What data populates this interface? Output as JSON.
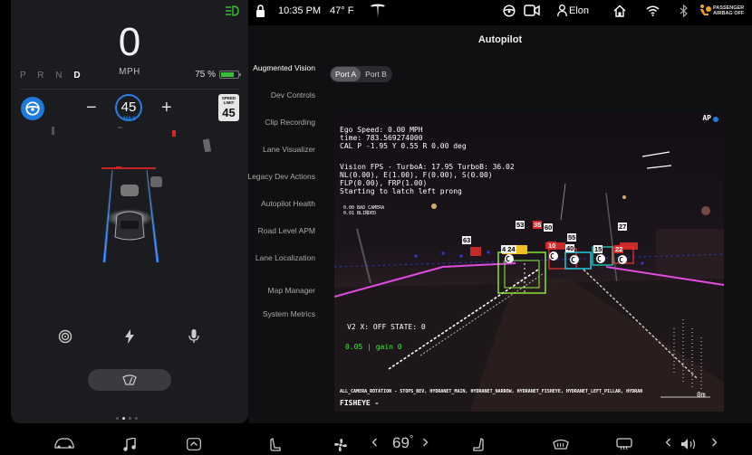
{
  "status_bar": {
    "time": "10:35 PM",
    "temperature": "47° F",
    "user": "Elon",
    "airbag_line1": "PASSENGER",
    "airbag_line2": "AIRBAG OFF"
  },
  "drive": {
    "speed": "0",
    "unit": "MPH",
    "gears": [
      "P",
      "R",
      "N",
      "D"
    ],
    "active_gear": "D",
    "battery_percent": "75 %",
    "battery_level": 0.75,
    "set_speed": "45",
    "set_speed_label": "MAX",
    "minus_label": "−",
    "plus_label": "+",
    "speed_limit_title": "SPEED LIMIT",
    "speed_limit_value": "45"
  },
  "autopilot": {
    "title": "Autopilot",
    "menu": [
      "Augmented Vision",
      "Dev Controls",
      "Clip Recording",
      "Lane Visualizer",
      "Legacy Dev Actions",
      "Autopilot Health",
      "Road Level APM",
      "Lane Localization",
      "Map Manager",
      "System Metrics"
    ],
    "ports": [
      "Port A",
      "Port B"
    ],
    "active_port": "Port A",
    "camera": {
      "badge": "AP",
      "telemetry": "Ego Speed: 0.00 MPH\ntime: 783.569274000\nCAL P -1.95 Y 0.55 R 0.00 deg",
      "vision": "Vision FPS - TurboA: 17.95 TurboB: 36.02\nNL(0.00), E(1.00), F(0.00), S(0.00)\nFLP(0.00), FRP(1.00)\nStarting to latch left prong",
      "camera_flags": "0.00 BAD_CAMERA\n0.01 BLINDED",
      "v2": "V2 X: OFF STATE: 0",
      "gain": "0.05 | gain 0",
      "rotation": "ALL_CAMERA_ROTATION - STOPS_BEV, HYDRANET_MAIN, HYDRANET_NARROW, HYDRANET_FISHEYE, HYDRANET_LEFT_PILLAR, HYDRAN",
      "fisheye": "FISHEYE -",
      "distance": "0m",
      "labels": [
        "53",
        "35",
        "60",
        "63",
        "4 24",
        "10",
        "40",
        "55",
        "15",
        "22",
        "27"
      ],
      "class_marker": "C"
    }
  },
  "bottom_bar": {
    "temperature": "69",
    "degree": "°"
  }
}
